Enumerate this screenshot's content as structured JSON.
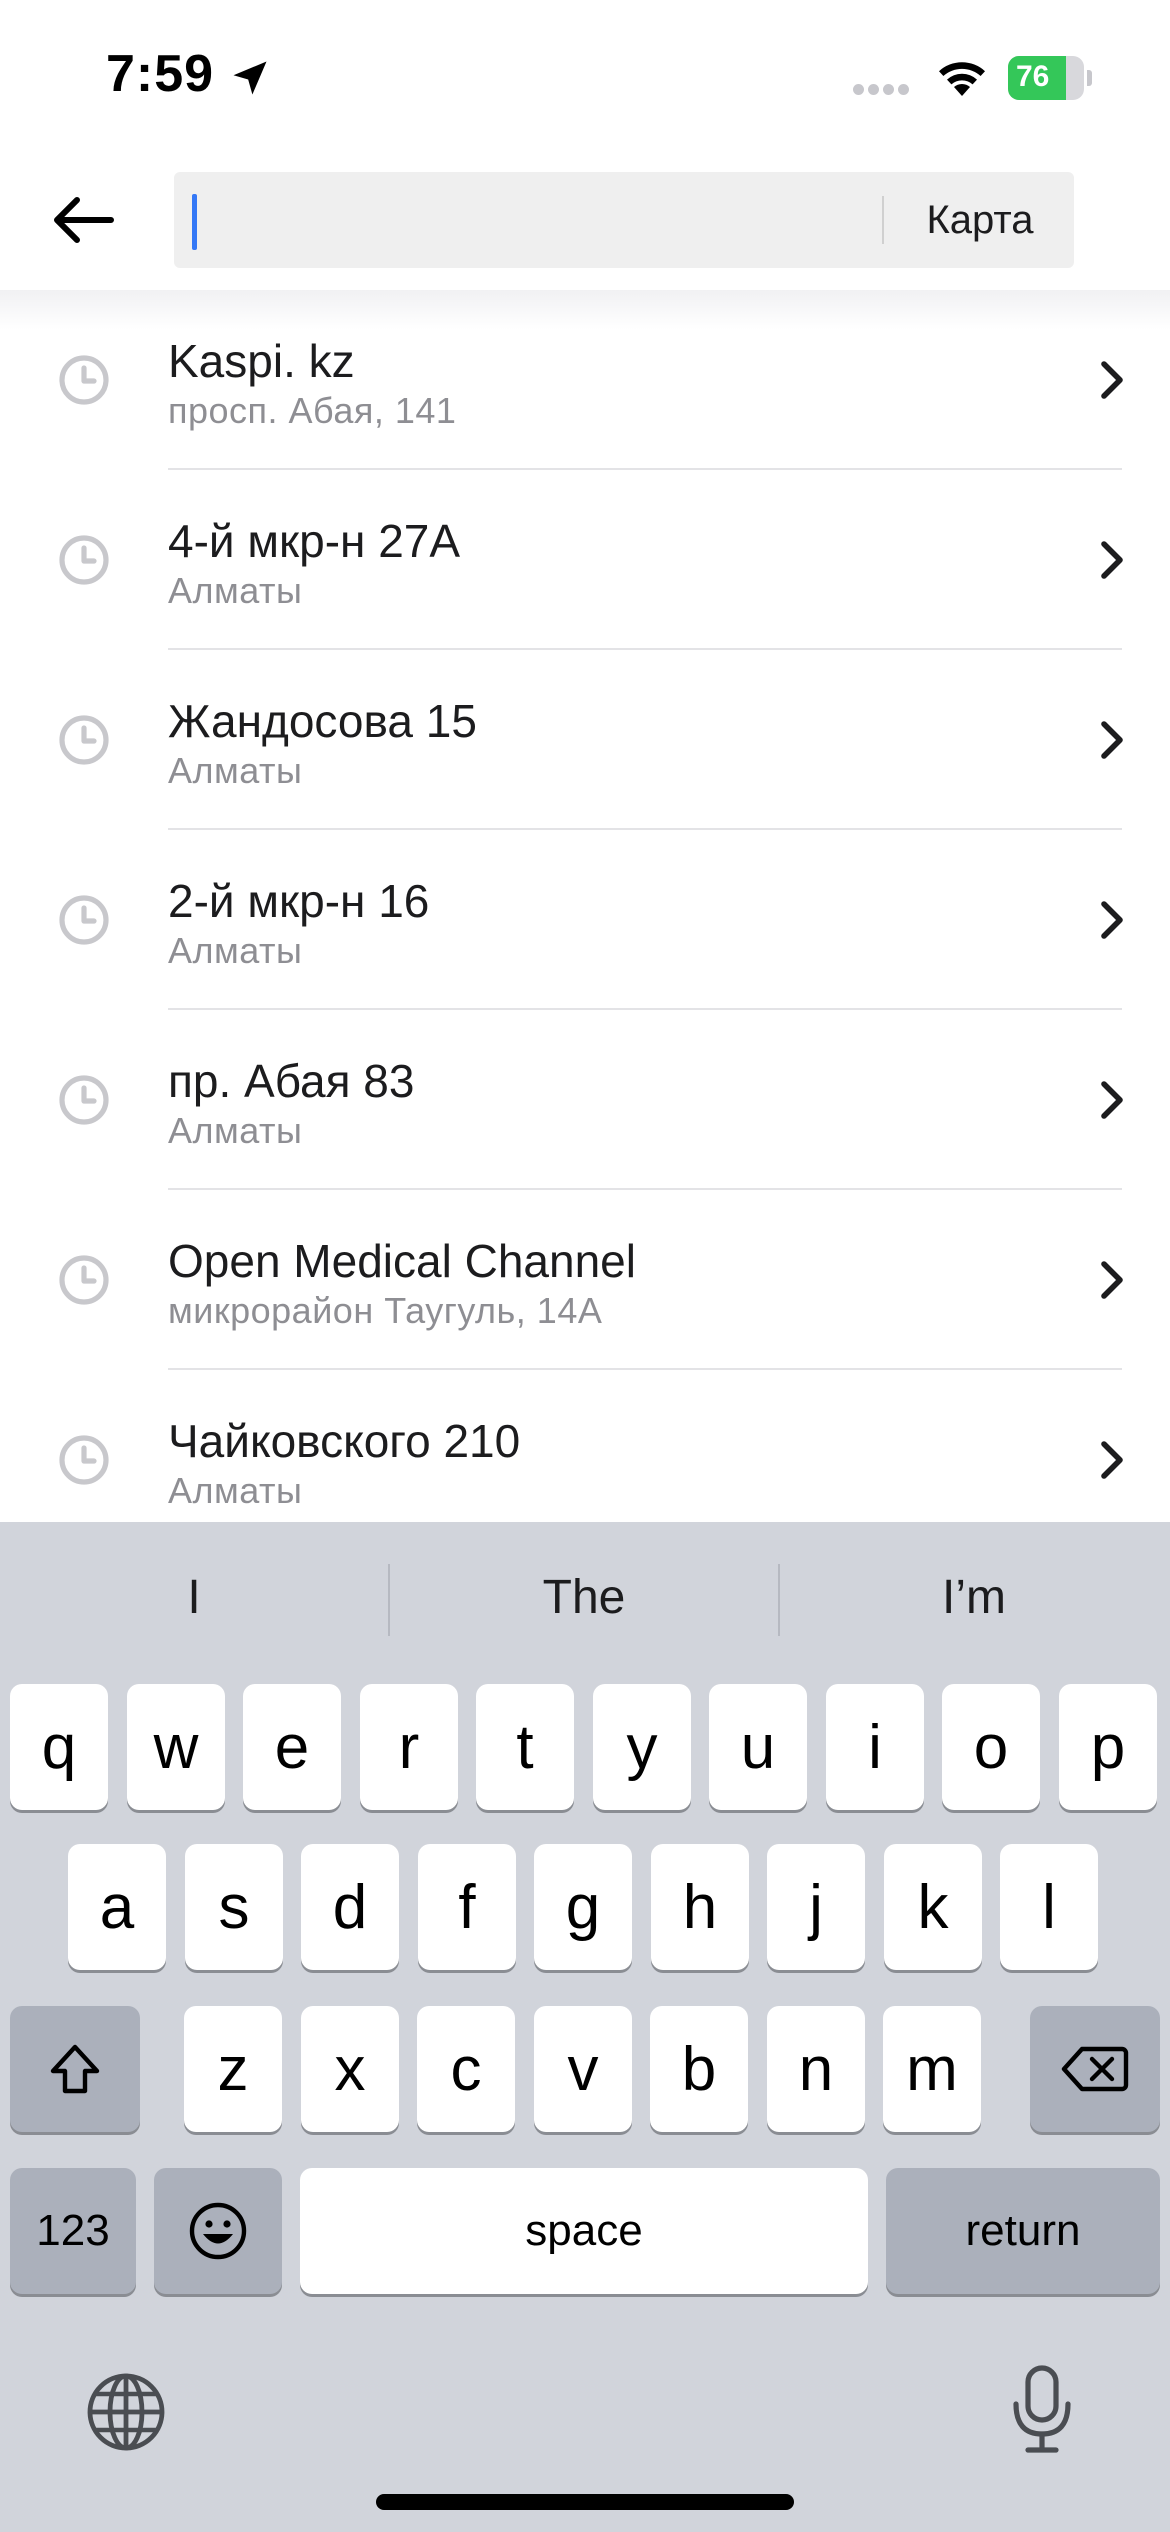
{
  "status_bar": {
    "time": "7:59",
    "battery_level": "76",
    "battery_percent": 76,
    "icons": [
      "location-arrow-icon",
      "signal-dots-icon",
      "wifi-icon",
      "battery-charging-icon"
    ]
  },
  "search": {
    "value": "",
    "map_label": "Карта",
    "back_icon": "arrow-left-icon"
  },
  "history": [
    {
      "title": "Kaspi. kz",
      "subtitle": "просп. Абая, 141"
    },
    {
      "title": "4-й мкр-н 27А",
      "subtitle": "Алматы"
    },
    {
      "title": "Жандосова 15",
      "subtitle": "Алматы"
    },
    {
      "title": "2-й мкр-н 16",
      "subtitle": "Алматы"
    },
    {
      "title": "пр. Абая 83",
      "subtitle": "Алматы"
    },
    {
      "title": "Open Medical Channel",
      "subtitle": "микрорайон Таугуль, 14А"
    },
    {
      "title": "Чайковского 210",
      "subtitle": "Алматы"
    }
  ],
  "keyboard": {
    "suggestions": [
      "I",
      "The",
      "I’m"
    ],
    "row1": [
      "q",
      "w",
      "e",
      "r",
      "t",
      "y",
      "u",
      "i",
      "o",
      "p"
    ],
    "row2": [
      "a",
      "s",
      "d",
      "f",
      "g",
      "h",
      "j",
      "k",
      "l"
    ],
    "row3": [
      "z",
      "x",
      "c",
      "v",
      "b",
      "n",
      "m"
    ],
    "numbers_label": "123",
    "space_label": "space",
    "return_label": "return"
  },
  "colors": {
    "caret": "#3478f6",
    "battery_fill": "#34c759",
    "keyboard_bg": "#d1d4db",
    "function_key": "#abb0bb"
  }
}
